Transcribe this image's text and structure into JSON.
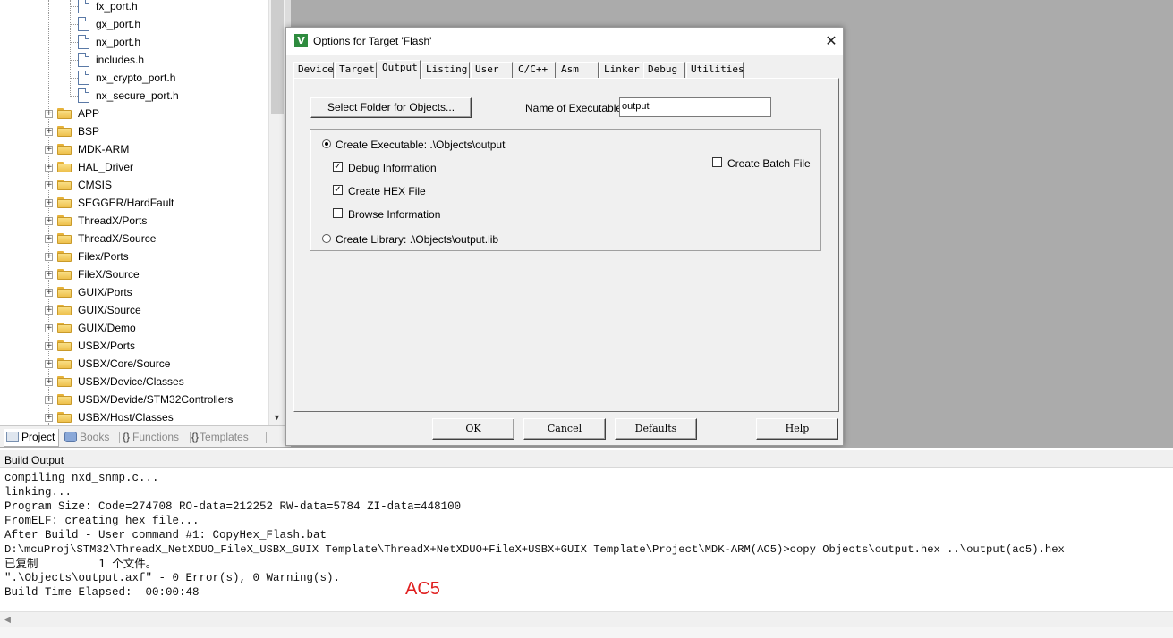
{
  "project_tree": {
    "files": [
      "fx_port.h",
      "gx_port.h",
      "nx_port.h",
      "includes.h",
      "nx_crypto_port.h",
      "nx_secure_port.h"
    ],
    "groups": [
      "APP",
      "BSP",
      "MDK-ARM",
      "HAL_Driver",
      "CMSIS",
      "SEGGER/HardFault",
      "ThreadX/Ports",
      "ThreadX/Source",
      "Filex/Ports",
      "FileX/Source",
      "GUIX/Ports",
      "GUIX/Source",
      "GUIX/Demo",
      "USBX/Ports",
      "USBX/Core/Source",
      "USBX/Device/Classes",
      "USBX/Devide/STM32Controllers",
      "USBX/Host/Classes"
    ],
    "expander_symbol": "+"
  },
  "panel_tabs": [
    {
      "label": "Project",
      "icon": "project-icon"
    },
    {
      "label": "Books",
      "icon": "books-icon"
    },
    {
      "label": "Functions",
      "icon": "functions-icon"
    },
    {
      "label": "Templates",
      "icon": "templates-icon"
    }
  ],
  "dialog": {
    "icon_letter": "V",
    "title": "Options for Target 'Flash'",
    "close_symbol": "✕",
    "tabs": [
      "Device",
      "Target",
      "Output",
      "Listing",
      "User",
      "C/C++",
      "Asm",
      "Linker",
      "Debug",
      "Utilities"
    ],
    "active_tab": "Output",
    "select_folder_label": "Select Folder for Objects...",
    "name_of_executable_label": "Name of Executable:",
    "name_of_executable_value": "output",
    "create_executable_label": "Create Executable:  .\\Objects\\output",
    "create_executable_checked": true,
    "debug_information_label": "Debug Information",
    "debug_information_checked": true,
    "create_hex_label": "Create HEX File",
    "create_hex_checked": true,
    "browse_information_label": "Browse Information",
    "browse_information_checked": false,
    "create_library_label": "Create Library:  .\\Objects\\output.lib",
    "create_library_checked": false,
    "create_batch_label": "Create Batch File",
    "create_batch_checked": false,
    "check_mark": "✓",
    "buttons": {
      "ok": "OK",
      "cancel": "Cancel",
      "defaults": "Defaults",
      "help": "Help"
    }
  },
  "build_output": {
    "title": "Build Output",
    "lines": [
      "compiling nxd_snmp.c...",
      "linking...",
      "Program Size: Code=274708 RO-data=212252 RW-data=5784 ZI-data=448100",
      "FromELF: creating hex file...",
      "After Build - User command #1: CopyHex_Flash.bat",
      "D:\\mcuProj\\STM32\\ThreadX_NetXDUO_FileX_USBX_GUIX Template\\ThreadX+NetXDUO+FileX+USBX+GUIX Template\\Project\\MDK-ARM(AC5)>copy Objects\\output.hex ..\\output(ac5).hex",
      "已复制         1 个文件。",
      "\".\\Objects\\output.axf\" - 0 Error(s), 0 Warning(s).",
      "Build Time Elapsed:  00:00:48"
    ],
    "annotation": "AC5"
  },
  "colors": {
    "annotation": "#e02020",
    "folder": "#eec04c",
    "app_icon": "#2e8b3e"
  }
}
